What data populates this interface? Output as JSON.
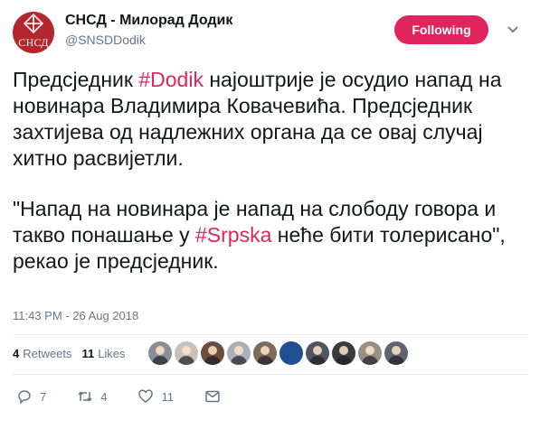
{
  "account": {
    "name": "СНСД - Милорад Додик",
    "handle": "@SNSDDodik",
    "avatar_text": "СНСД",
    "follow_label": "Following"
  },
  "tweet": {
    "p1_a": "Предсједник ",
    "p1_tag": "#Dodik",
    "p1_b": " најоштрије је осудио напад на новинара Владимира Ковачевића. Предсједник захтијева од надлежних органа да се овај случај хитно расвијетли.",
    "p2_a": "\"Напад на новинара је напад на слободу говора и такво понашање у ",
    "p2_tag": "#Srpska",
    "p2_b": " неће бити толерисано\", рекао је предсједник."
  },
  "timestamp": "11:43 PM - 26 Aug 2018",
  "stats": {
    "retweets_count": "4",
    "retweets_label": "Retweets",
    "likes_count": "11",
    "likes_label": "Likes"
  },
  "liker_avatars": [
    "#8a8f96",
    "#c9c2b8",
    "#6b4e3d",
    "#a9b0b8",
    "#7d6a5a",
    "#1d4f91",
    "#4d5660",
    "#3b3b3b",
    "#9a8f86",
    "#5d6670"
  ],
  "actions": {
    "replies": "7",
    "retweets": "4",
    "likes": "11"
  },
  "colors": {
    "accent": "#e0245e",
    "text": "#14171a",
    "muted": "#657786",
    "avatar_bg": "#b3262d"
  }
}
